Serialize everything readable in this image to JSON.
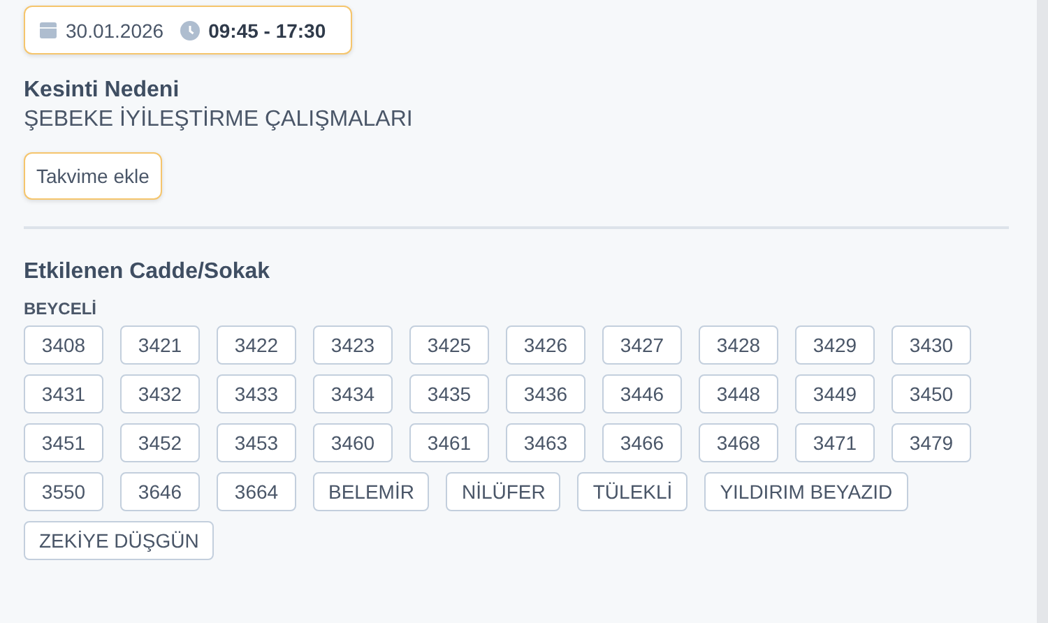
{
  "schedule": {
    "date": "30.01.2026",
    "time": "09:45 - 17:30"
  },
  "reason": {
    "label": "Kesinti Nedeni",
    "value": "ŞEBEKE İYİLEŞTİRME ÇALIŞMALARI"
  },
  "calendar_button": "Takvime ekle",
  "affected": {
    "title": "Etkilenen Cadde/Sokak",
    "district": "BEYCELİ",
    "streets": [
      "3408",
      "3421",
      "3422",
      "3423",
      "3425",
      "3426",
      "3427",
      "3428",
      "3429",
      "3430",
      "3431",
      "3432",
      "3433",
      "3434",
      "3435",
      "3436",
      "3446",
      "3448",
      "3449",
      "3450",
      "3451",
      "3452",
      "3453",
      "3460",
      "3461",
      "3463",
      "3466",
      "3468",
      "3471",
      "3479",
      "3550",
      "3646",
      "3664",
      "BELEMİR",
      "NİLÜFER",
      "TÜLEKLİ",
      "YILDIRIM BEYAZID",
      "ZEKİYE DÜŞGÜN"
    ]
  }
}
